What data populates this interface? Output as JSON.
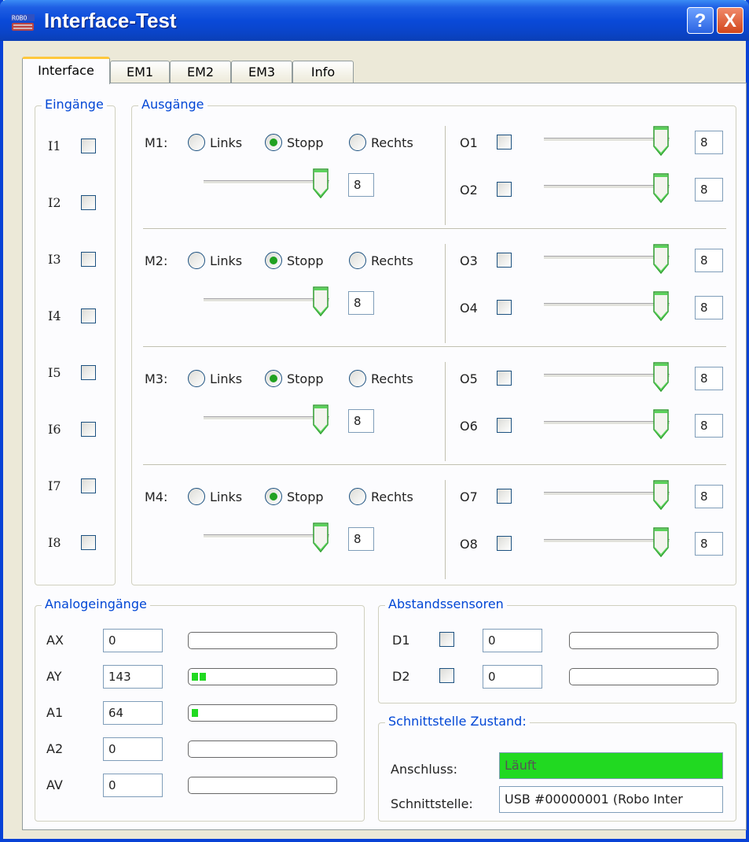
{
  "window": {
    "title": "Interface-Test",
    "help_label": "?",
    "close_label": "X",
    "icon_text": "ROBO"
  },
  "tabs": [
    "Interface",
    "EM1",
    "EM2",
    "EM3",
    "Info"
  ],
  "inputs": {
    "label": "Eingänge",
    "items": [
      {
        "label": "I1",
        "checked": false
      },
      {
        "label": "I2",
        "checked": false
      },
      {
        "label": "I3",
        "checked": false
      },
      {
        "label": "I4",
        "checked": false
      },
      {
        "label": "I5",
        "checked": false
      },
      {
        "label": "I6",
        "checked": false
      },
      {
        "label": "I7",
        "checked": false
      },
      {
        "label": "I8",
        "checked": false
      }
    ]
  },
  "outputs": {
    "label": "Ausgänge",
    "radio_labels": {
      "left": "Links",
      "stop": "Stopp",
      "right": "Rechts"
    },
    "motors": [
      {
        "label": "M1:",
        "selected": "stop",
        "value": "8",
        "level": 1.0
      },
      {
        "label": "M2:",
        "selected": "stop",
        "value": "8",
        "level": 1.0
      },
      {
        "label": "M3:",
        "selected": "stop",
        "value": "8",
        "level": 1.0
      },
      {
        "label": "M4:",
        "selected": "stop",
        "value": "8",
        "level": 1.0
      }
    ],
    "outs": [
      {
        "label": "O1",
        "checked": false,
        "value": "8",
        "level": 1.0
      },
      {
        "label": "O2",
        "checked": false,
        "value": "8",
        "level": 1.0
      },
      {
        "label": "O3",
        "checked": false,
        "value": "8",
        "level": 1.0
      },
      {
        "label": "O4",
        "checked": false,
        "value": "8",
        "level": 1.0
      },
      {
        "label": "O5",
        "checked": false,
        "value": "8",
        "level": 1.0
      },
      {
        "label": "O6",
        "checked": false,
        "value": "8",
        "level": 1.0
      },
      {
        "label": "O7",
        "checked": false,
        "value": "8",
        "level": 1.0
      },
      {
        "label": "O8",
        "checked": false,
        "value": "8",
        "level": 1.0
      }
    ]
  },
  "analog": {
    "label": "Analogeingänge",
    "items": [
      {
        "label": "AX",
        "value": "0",
        "segments": 0
      },
      {
        "label": "AY",
        "value": "143",
        "segments": 2
      },
      {
        "label": "A1",
        "value": "64",
        "segments": 1
      },
      {
        "label": "A2",
        "value": "0",
        "segments": 0
      },
      {
        "label": "AV",
        "value": "0",
        "segments": 0
      }
    ],
    "bar_color": "#21d921"
  },
  "distance": {
    "label": "Abstandssensoren",
    "items": [
      {
        "label": "D1",
        "checked": false,
        "value": "0",
        "segments": 0
      },
      {
        "label": "D2",
        "checked": false,
        "value": "0",
        "segments": 0
      }
    ]
  },
  "status": {
    "label": "Schnittstelle Zustand:",
    "connection_label": "Anschluss:",
    "connection_value": "Läuft",
    "connection_color": "#21d921",
    "interface_label": "Schnittstelle:",
    "interface_value": "USB #00000001 (Robo Inter"
  }
}
